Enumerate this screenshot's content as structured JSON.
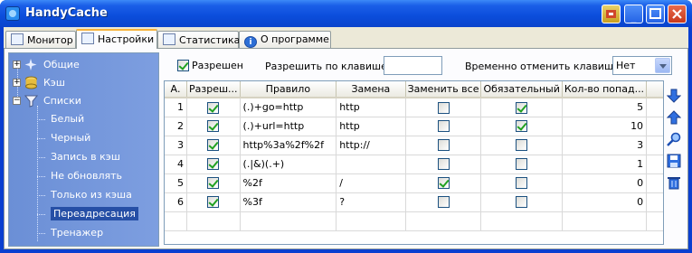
{
  "window": {
    "title": "HandyCache"
  },
  "tabs": [
    {
      "label": "Монитор",
      "icon": "monitor-grid-icon",
      "active": false
    },
    {
      "label": "Настройки",
      "icon": "settings-list-icon",
      "active": true
    },
    {
      "label": "Статистика",
      "icon": "statistics-icon",
      "active": false
    },
    {
      "label": "О программе",
      "icon": "info-icon",
      "active": false
    }
  ],
  "tree": {
    "items": [
      {
        "label": "Общие",
        "icon": "sparkle-icon",
        "expander": "+"
      },
      {
        "label": "Кэш",
        "icon": "database-icon",
        "expander": "+"
      },
      {
        "label": "Списки",
        "icon": "funnel-icon",
        "expander": "−"
      },
      {
        "label": "Белый"
      },
      {
        "label": "Черный"
      },
      {
        "label": "Запись в кэш"
      },
      {
        "label": "Не обновлять"
      },
      {
        "label": "Только из кэша"
      },
      {
        "label": "Переадресация",
        "selected": true
      },
      {
        "label": "Тренажер"
      }
    ]
  },
  "toolbar": {
    "enabled_label": "Разрешен",
    "enabled": true,
    "hotkey_label": "Разрешить по клавише:",
    "hotkey_value": "",
    "temp_disable_label": "Временно отменить клавишей:",
    "temp_disable_value": "Нет"
  },
  "table": {
    "columns": [
      "А.",
      "Разреш...",
      "Правило",
      "Замена",
      "Заменить все",
      "Обязательный",
      "Кол-во попад..."
    ],
    "rows": [
      {
        "n": "1",
        "enabled": true,
        "rule": "(.)+go=http",
        "replace": "http",
        "replace_all": false,
        "required": true,
        "hits": "5"
      },
      {
        "n": "2",
        "enabled": true,
        "rule": "(.)+url=http",
        "replace": "http",
        "replace_all": false,
        "required": true,
        "hits": "10"
      },
      {
        "n": "3",
        "enabled": true,
        "rule": "http%3a%2f%2f",
        "replace": "http://",
        "replace_all": false,
        "required": false,
        "hits": "3"
      },
      {
        "n": "4",
        "enabled": true,
        "rule": "(.|&)(.+)",
        "replace": "",
        "replace_all": false,
        "required": false,
        "hits": "1"
      },
      {
        "n": "5",
        "enabled": true,
        "rule": "%2f",
        "replace": "/",
        "replace_all": true,
        "required": false,
        "hits": "0"
      },
      {
        "n": "6",
        "enabled": true,
        "rule": "%3f",
        "replace": "?",
        "replace_all": false,
        "required": false,
        "hits": "0"
      },
      {
        "n": "",
        "enabled": null,
        "rule": "",
        "replace": "",
        "replace_all": null,
        "required": null,
        "hits": ""
      }
    ]
  },
  "side_tools": [
    {
      "name": "move-down-icon"
    },
    {
      "name": "move-up-icon"
    },
    {
      "name": "search-icon"
    },
    {
      "name": "save-icon"
    },
    {
      "name": "delete-icon"
    }
  ]
}
